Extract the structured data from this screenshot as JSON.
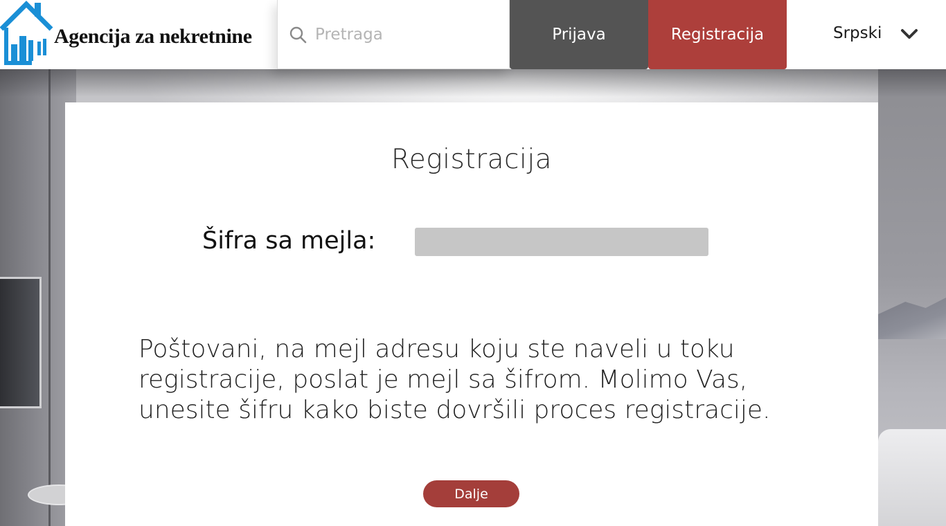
{
  "header": {
    "logo_text": "Agencija za nekretnine",
    "search": {
      "placeholder": "Pretraga",
      "value": ""
    },
    "login_label": "Prijava",
    "register_label": "Registracija",
    "language": {
      "selected": "Srpski"
    }
  },
  "card": {
    "title": "Registracija",
    "code_label": "Šifra sa mejla:",
    "code_value": "",
    "message": "Poštovani, na mejl adresu koju ste naveli u toku registracije, poslat je mejl sa šifrom. Molimo Vas, unesite šifru kako biste dovršili proces registracije.",
    "next_label": "Dalje"
  },
  "colors": {
    "accent_red": "#ad3f3b",
    "button_dark": "#545454",
    "logo_blue": "#1a8fd6",
    "input_gray": "#c6c6c6"
  },
  "icons": [
    "house-logo-icon",
    "search-icon",
    "chevron-down-icon"
  ]
}
